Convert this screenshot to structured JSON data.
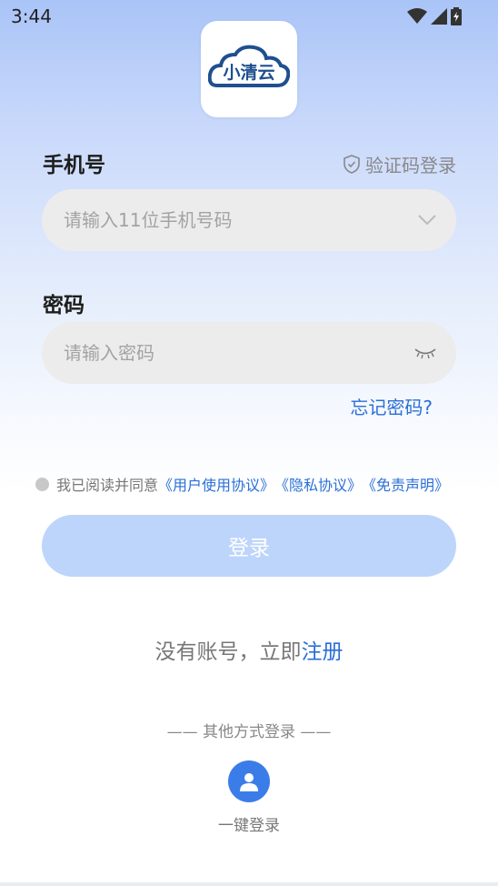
{
  "status_bar": {
    "time": "3:44"
  },
  "logo": {
    "text": "小清云"
  },
  "phone": {
    "label": "手机号",
    "placeholder": "请输入11位手机号码",
    "sms_login": "验证码登录"
  },
  "password": {
    "label": "密码",
    "placeholder": "请输入密码",
    "forgot": "忘记密码?"
  },
  "agreement": {
    "prefix": "我已阅读并同意",
    "user_agreement": "《用户使用协议》",
    "privacy": "《隐私协议》",
    "disclaimer": "《免责声明》"
  },
  "login_button": "登录",
  "register": {
    "prefix": "没有账号，立即",
    "link": "注册"
  },
  "other_login": {
    "title": "—— 其他方式登录 ——",
    "one_key_label": "一键登录"
  },
  "colors": {
    "accent": "#2a6fd6",
    "button_disabled": "#bdd5fb",
    "logo_blue": "#1f4f8f"
  }
}
